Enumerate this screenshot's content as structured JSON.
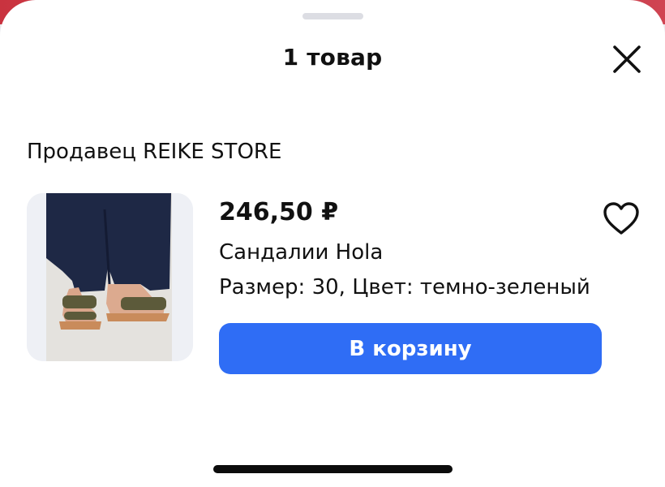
{
  "sheet": {
    "title": "1 товар",
    "close_icon": "close-icon"
  },
  "seller": {
    "label": "Продавец REIKE STORE"
  },
  "product": {
    "image": "sandals-photo",
    "price": "246,50 ₽",
    "name": "Сандалии Hola",
    "attributes": "Размер: 30, Цвет: темно-зеленый",
    "favorite_icon": "heart-icon",
    "add_to_cart_label": "В корзину"
  },
  "colors": {
    "accent": "#2f6df5",
    "text": "#111111",
    "thumb_bg": "#eef0f5"
  }
}
